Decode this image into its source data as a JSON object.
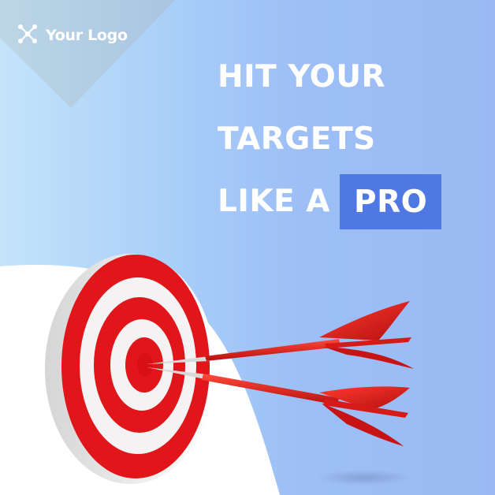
{
  "brand": {
    "logo_text": "Your Logo",
    "icon": "network-icon"
  },
  "headline": {
    "line1": "HIT YOUR",
    "line2": "TARGETS",
    "line3": "LIKE A",
    "highlight": "PRO"
  },
  "colors": {
    "background_left": "#c4e4fa",
    "background_right": "#9ab9f4",
    "highlight_box": "#4f78e3",
    "target_red": "#e0161a",
    "text": "#ffffff"
  }
}
